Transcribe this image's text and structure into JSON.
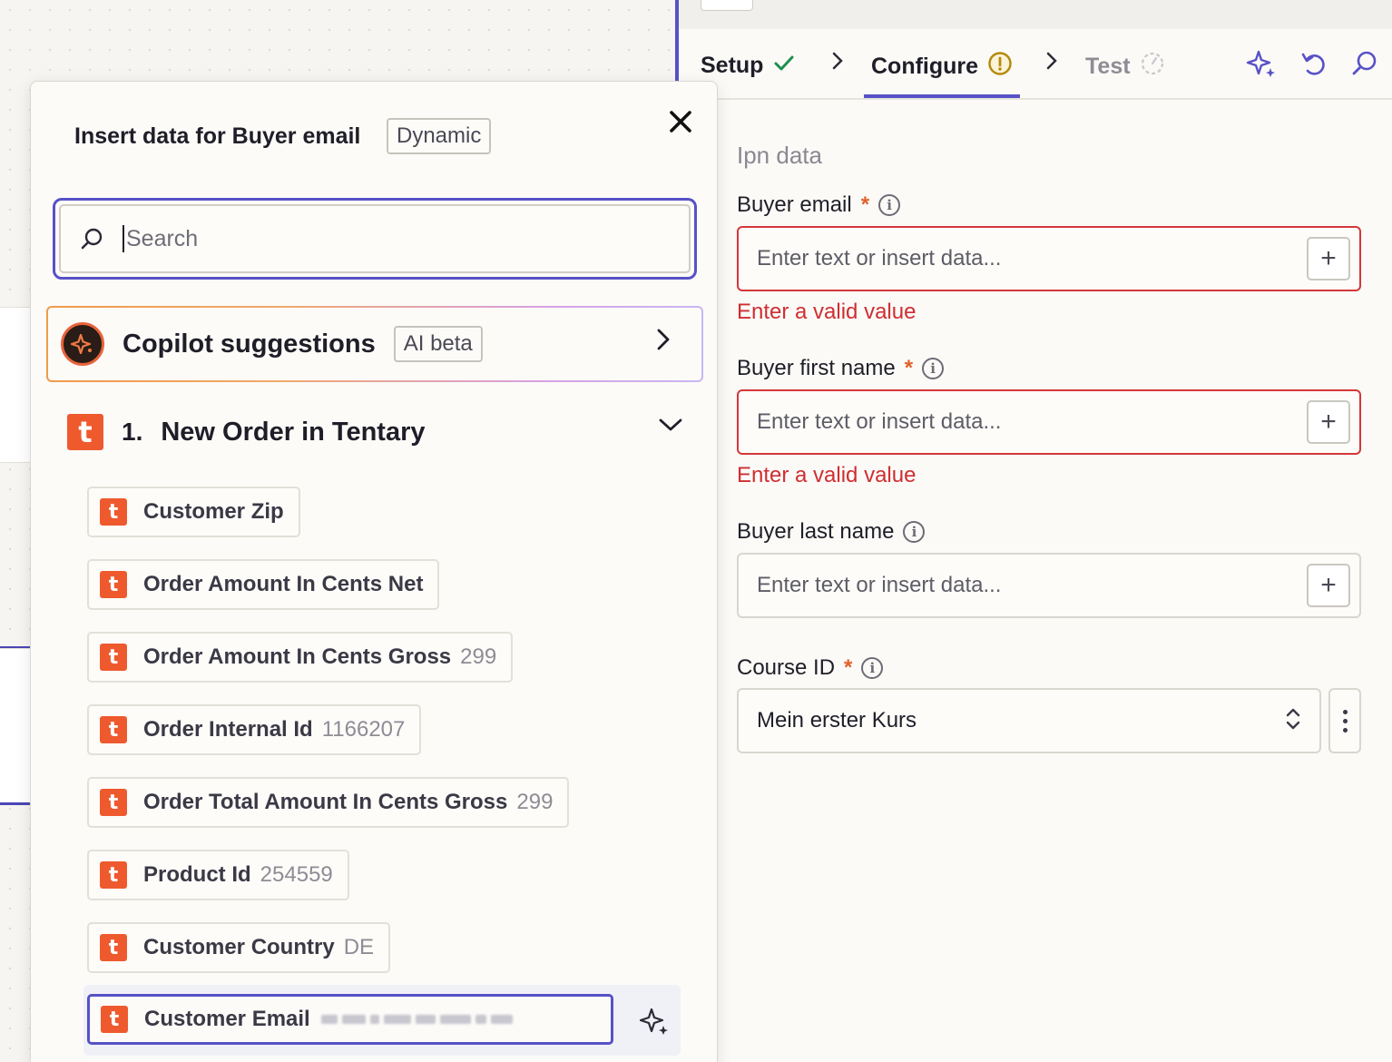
{
  "tabs": {
    "setup": "Setup",
    "configure": "Configure",
    "test": "Test"
  },
  "form": {
    "section_title": "Ipn data",
    "fields": [
      {
        "label": "Buyer email",
        "required": true,
        "placeholder": "Enter text or insert data...",
        "error": "Enter a valid value"
      },
      {
        "label": "Buyer first name",
        "required": true,
        "placeholder": "Enter text or insert data...",
        "error": "Enter a valid value"
      },
      {
        "label": "Buyer last name",
        "required": false,
        "placeholder": "Enter text or insert data...",
        "error": ""
      }
    ],
    "course": {
      "label": "Course ID",
      "required": true,
      "value": "Mein erster Kurs"
    },
    "required_mark": "*",
    "info_glyph": "i",
    "plus_glyph": "+"
  },
  "picker": {
    "title": "Insert data for Buyer email",
    "badge": "Dynamic",
    "close_glyph": "✕",
    "search_placeholder": "Search",
    "copilot": {
      "label": "Copilot suggestions",
      "badge": "AI beta"
    },
    "step": {
      "number": "1.",
      "title": "New Order in Tentary",
      "logo_letter": "t"
    },
    "items": [
      {
        "label": "Customer Zip",
        "value": ""
      },
      {
        "label": "Order Amount In Cents Net",
        "value": ""
      },
      {
        "label": "Order Amount In Cents Gross",
        "value": "299"
      },
      {
        "label": "Order Internal Id",
        "value": "1166207"
      },
      {
        "label": "Order Total Amount In Cents Gross",
        "value": "299"
      },
      {
        "label": "Product Id",
        "value": "254559"
      },
      {
        "label": "Customer Country",
        "value": "DE"
      },
      {
        "label": "Customer Email",
        "value": ""
      }
    ]
  },
  "colors": {
    "accent": "#5751c7",
    "error": "#d4373a",
    "brand_tentary": "#ee5a2e",
    "success": "#1f8f4e",
    "warning": "#b58a10"
  },
  "icons": {
    "setup_status": "check-icon",
    "configure_status": "warning-circle-icon",
    "test_status": "timer-icon",
    "tools": [
      "sparkle-icon",
      "undo-icon",
      "search-icon"
    ]
  }
}
